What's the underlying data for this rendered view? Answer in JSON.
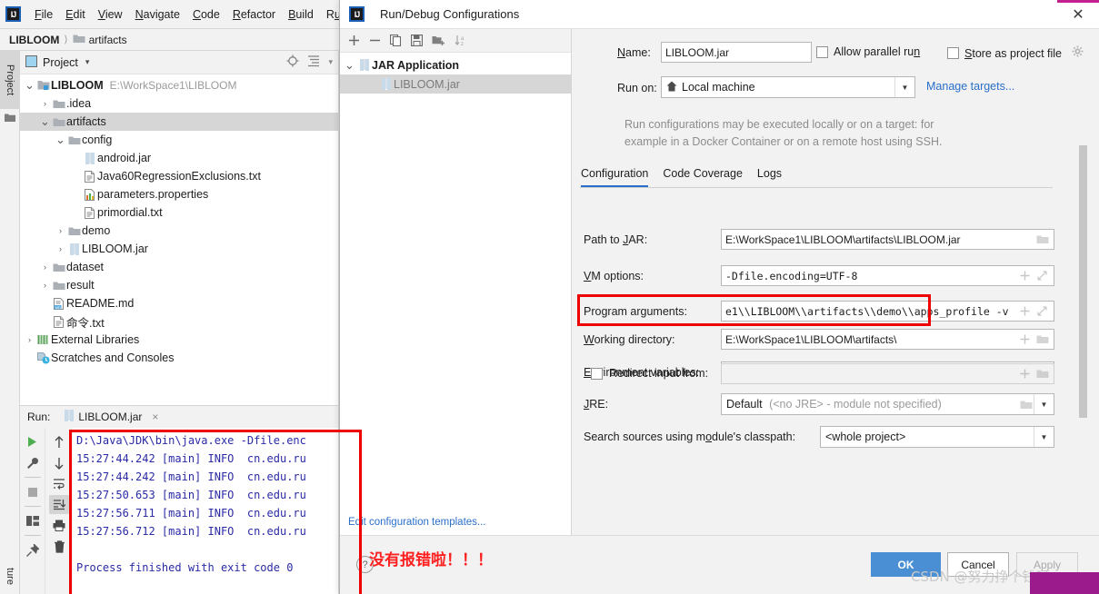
{
  "app": {
    "logo": "intellij-idea-logo",
    "menu": [
      "File",
      "Edit",
      "View",
      "Navigate",
      "Code",
      "Refactor",
      "Build",
      "Run"
    ]
  },
  "breadcrumb": {
    "project": "LIBLOOM",
    "separator": "〉",
    "item": "artifacts"
  },
  "left_strip": {
    "tabs": [
      "Project",
      "Structure"
    ],
    "structure_partial": "ture"
  },
  "project_panel": {
    "title": "Project",
    "caret": "▾",
    "icons": [
      "locate-icon",
      "collapse-all-icon",
      "chevron-down-icon"
    ],
    "tree": [
      {
        "indent": 0,
        "arrow": "⌄",
        "icon": "module-icon",
        "label": "LIBLOOM",
        "bold": true,
        "path": "E:\\WorkSpace1\\LIBLOOM",
        "selected": false
      },
      {
        "indent": 1,
        "arrow": "›",
        "icon": "folder-icon",
        "label": ".idea",
        "bold": false,
        "path": "",
        "selected": false
      },
      {
        "indent": 1,
        "arrow": "⌄",
        "icon": "folder-icon",
        "label": "artifacts",
        "bold": false,
        "path": "",
        "selected": true
      },
      {
        "indent": 2,
        "arrow": "⌄",
        "icon": "folder-icon",
        "label": "config",
        "bold": false,
        "path": "",
        "selected": false
      },
      {
        "indent": 3,
        "arrow": "",
        "icon": "jar-icon",
        "label": "android.jar",
        "bold": false,
        "path": "",
        "selected": false
      },
      {
        "indent": 3,
        "arrow": "",
        "icon": "text-file-icon",
        "label": "Java60RegressionExclusions.txt",
        "bold": false,
        "path": "",
        "selected": false
      },
      {
        "indent": 3,
        "arrow": "",
        "icon": "properties-file-icon",
        "label": "parameters.properties",
        "bold": false,
        "path": "",
        "selected": false
      },
      {
        "indent": 3,
        "arrow": "",
        "icon": "text-file-icon",
        "label": "primordial.txt",
        "bold": false,
        "path": "",
        "selected": false
      },
      {
        "indent": 2,
        "arrow": "›",
        "icon": "folder-icon",
        "label": "demo",
        "bold": false,
        "path": "",
        "selected": false
      },
      {
        "indent": 2,
        "arrow": "›",
        "icon": "jar-icon",
        "label": "LIBLOOM.jar",
        "bold": false,
        "path": "",
        "selected": false
      },
      {
        "indent": 1,
        "arrow": "›",
        "icon": "folder-icon",
        "label": "dataset",
        "bold": false,
        "path": "",
        "selected": false
      },
      {
        "indent": 1,
        "arrow": "›",
        "icon": "folder-icon",
        "label": "result",
        "bold": false,
        "path": "",
        "selected": false
      },
      {
        "indent": 1,
        "arrow": "",
        "icon": "markdown-file-icon",
        "label": "README.md",
        "bold": false,
        "path": "",
        "selected": false
      },
      {
        "indent": 1,
        "arrow": "",
        "icon": "text-file-icon",
        "label": "命令.txt",
        "bold": false,
        "path": "",
        "selected": false
      },
      {
        "indent": 0,
        "arrow": "›",
        "icon": "library-icon",
        "label": "External Libraries",
        "bold": false,
        "path": "",
        "selected": false
      },
      {
        "indent": 0,
        "arrow": "",
        "icon": "scratches-icon",
        "label": "Scratches and Consoles",
        "bold": false,
        "path": "",
        "selected": false
      }
    ]
  },
  "run_window": {
    "label": "Run:",
    "tab_label": "LIBLOOM.jar",
    "tab_icon": "jar-icon",
    "close": "×",
    "toolbar_left": [
      "run-icon",
      "wrench-icon",
      "stop-icon",
      "layout-icon",
      "pin-icon"
    ],
    "toolbar_right": [
      "up-arrow-icon",
      "down-arrow-icon",
      "soft-wrap-icon",
      "scroll-to-end-icon",
      "print-icon",
      "trash-icon"
    ],
    "console_lines": [
      "D:\\Java\\JDK\\bin\\java.exe -Dfile.enc",
      "15:27:44.242 [main] INFO  cn.edu.ru",
      "15:27:44.242 [main] INFO  cn.edu.ru",
      "15:27:50.653 [main] INFO  cn.edu.ru",
      "15:27:56.711 [main] INFO  cn.edu.ru",
      "15:27:56.712 [main] INFO  cn.edu.ru",
      "",
      "Process finished with exit code 0"
    ],
    "console_color": "#2a2aa5"
  },
  "dialog": {
    "title": "Run/Debug Configurations",
    "title_icon": "intellij-idea-logo",
    "close_icon": "✕",
    "toolbar": [
      "add-icon",
      "remove-icon",
      "copy-icon",
      "save-icon",
      "new-folder-icon",
      "sort-alphabetically-icon"
    ],
    "tree": [
      {
        "arrow": "⌄",
        "icon": "jar-icon",
        "label": "JAR Application",
        "bold": true,
        "selected": false,
        "indent": 0
      },
      {
        "arrow": "",
        "icon": "jar-icon",
        "label": "LIBLOOM.jar",
        "bold": false,
        "selected": true,
        "indent": 1
      }
    ],
    "edit_templates_link": "Edit configuration templates...",
    "name_label": "Name:",
    "name_label_mnemonic": "N",
    "name_value": "LIBLOOM.jar",
    "allow_parallel_run": "Allow parallel run",
    "allow_parallel_run_checked": false,
    "store_as_project_file": "Store as project file",
    "store_as_project_file_checked": false,
    "store_gear_icon": "gear-icon",
    "run_on_label": "Run on:",
    "run_on_value": "Local machine",
    "run_on_icon": "home-icon",
    "manage_targets_link": "Manage targets...",
    "help_text_line1": "Run configurations may be executed locally or on a target: for",
    "help_text_line2": "example in a Docker Container or on a remote host using SSH.",
    "tabs": [
      {
        "label": "Configuration",
        "selected": true
      },
      {
        "label": "Code Coverage",
        "selected": false
      },
      {
        "label": "Logs",
        "selected": false
      }
    ],
    "fields": [
      {
        "label": "Path to JAR:",
        "mnemonic": "J",
        "value": "E:\\WorkSpace1\\LIBLOOM\\artifacts\\LIBLOOM.jar",
        "mono": false,
        "icons": [
          "folder-icon"
        ],
        "disabled": false
      },
      {
        "label": "VM options:",
        "mnemonic": "V",
        "value": "-Dfile.encoding=UTF-8",
        "mono": true,
        "icons": [
          "plus-icon",
          "expand-icon"
        ],
        "disabled": false
      },
      {
        "label": "Program arguments:",
        "mnemonic": "g",
        "value": "e1\\\\LIBLOOM\\\\artifacts\\\\demo\\\\apps_profile -v",
        "mono": true,
        "icons": [
          "plus-icon",
          "expand-icon"
        ],
        "disabled": false
      },
      {
        "label": "Working directory:",
        "mnemonic": "W",
        "value": "E:\\WorkSpace1\\LIBLOOM\\artifacts\\",
        "mono": false,
        "icons": [
          "plus-icon",
          "folder-icon"
        ],
        "disabled": false
      },
      {
        "label": "Environment variables:",
        "mnemonic": "E",
        "value": "",
        "mono": false,
        "icons": [
          "list-icon"
        ],
        "disabled": false
      }
    ],
    "redirect_input_label": "Redirect input from:",
    "redirect_input_checked": false,
    "redirect_input_value": "",
    "redirect_icons": [
      "plus-icon",
      "folder-icon"
    ],
    "jre_label": "JRE:",
    "jre_mnemonic": "J",
    "jre_value_main": "Default",
    "jre_value_dim": "(<no JRE> - module not specified)",
    "jre_icons": [
      "folder-icon",
      "chevron-down-icon"
    ],
    "search_sources_label": "Search sources using module's classpath:",
    "search_sources_value": "<whole project>",
    "buttons": {
      "ok": "OK",
      "cancel": "Cancel",
      "apply": "Apply",
      "apply_disabled": true,
      "help": "?"
    },
    "accent_color": "#4a8fd4",
    "link_color": "#2a6fc9"
  },
  "annotations": {
    "red_color": "#ee0000",
    "working_dir_highlight": "working-directory-field-highlight",
    "console_highlight": "console-output-highlight",
    "callout_text": "没有报错啦！！！"
  },
  "watermark": {
    "text": "CSDN @努力挣个钱呀"
  }
}
